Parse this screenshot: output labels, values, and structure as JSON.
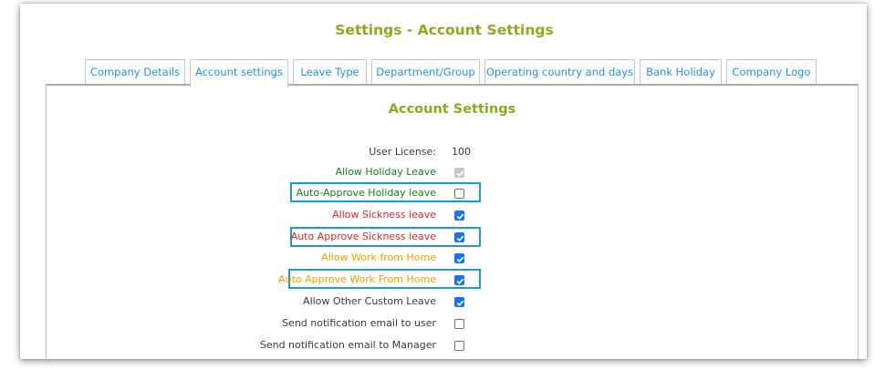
{
  "page_title": "Settings - Account Settings",
  "tabs": [
    {
      "label": "Company Details",
      "active": false
    },
    {
      "label": "Account settings",
      "active": true
    },
    {
      "label": "Leave Type",
      "active": false
    },
    {
      "label": "Department/Group",
      "active": false
    },
    {
      "label": "Operating country and days",
      "active": false
    },
    {
      "label": "Bank Holiday",
      "active": false
    },
    {
      "label": "Company Logo",
      "active": false
    }
  ],
  "panel": {
    "title": "Account Settings",
    "user_license": {
      "label": "User License:",
      "value": "100"
    },
    "settings": [
      {
        "label": "Allow Holiday Leave",
        "checked": true,
        "disabled": true,
        "color": "#1c7a1c",
        "highlighted": false
      },
      {
        "label": "Auto-Approve Holiday leave",
        "checked": false,
        "disabled": false,
        "color": "#1c7a1c",
        "highlighted": true
      },
      {
        "label": "Allow Sickness leave",
        "checked": true,
        "disabled": false,
        "color": "#e52323",
        "highlighted": false
      },
      {
        "label": "Auto Approve Sickness leave",
        "checked": true,
        "disabled": false,
        "color": "#e52323",
        "highlighted": true
      },
      {
        "label": "Allow Work from Home",
        "checked": true,
        "disabled": false,
        "color": "#f0a000",
        "highlighted": false
      },
      {
        "label": "Auto Approve Work From Home",
        "checked": true,
        "disabled": false,
        "color": "#f0a000",
        "highlighted": true
      },
      {
        "label": "Allow Other Custom Leave",
        "checked": true,
        "disabled": false,
        "color": "#3a3a3a",
        "highlighted": false
      },
      {
        "label": "Send notification email to user",
        "checked": false,
        "disabled": false,
        "color": "#3a3a3a",
        "highlighted": false
      },
      {
        "label": "Send notification email to Manager",
        "checked": false,
        "disabled": false,
        "color": "#3a3a3a",
        "highlighted": false
      }
    ]
  },
  "colors": {
    "title_green": "#8aab1e",
    "tab_blue": "#1f95d3",
    "highlight_blue": "#1c9ad6",
    "checkbox_blue": "#1a73e8"
  },
  "icons": {
    "checkbox_checked": "check-mark-icon"
  }
}
